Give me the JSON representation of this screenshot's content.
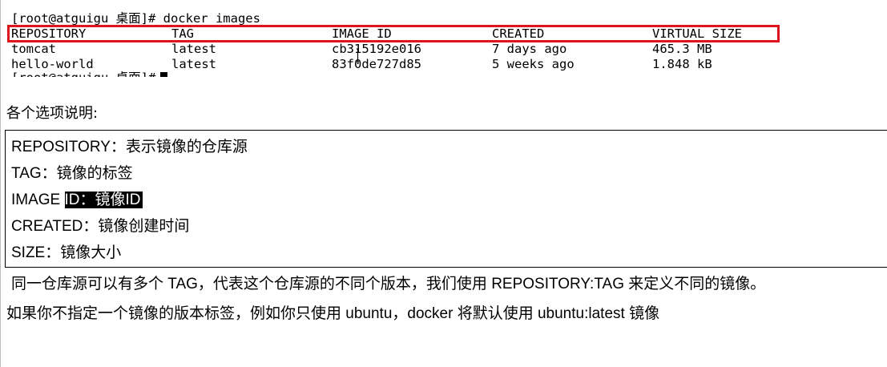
{
  "terminal": {
    "prompt_line": "[root@atguigu 桌面]# docker images",
    "headers": [
      "REPOSITORY",
      "TAG",
      "IMAGE ID",
      "CREATED",
      "VIRTUAL SIZE"
    ],
    "rows": [
      [
        "tomcat",
        "latest",
        "cb315192e016",
        "7 days ago",
        "465.3 MB"
      ],
      [
        "hello-world",
        "latest",
        "83f0de727d85",
        "5 weeks ago",
        "1.848 kB"
      ]
    ],
    "next_prompt": "[root@atguigu 桌面]#",
    "highlight_color": "#e0141b"
  },
  "doc": {
    "heading": "各个选项说明:",
    "options": [
      {
        "key": "REPOSITORY",
        "sep": "：",
        "desc": "表示镜像的仓库源"
      },
      {
        "key": "TAG",
        "sep": "：",
        "desc": "镜像的标签"
      },
      {
        "key": "IMAGE ",
        "sep": "",
        "desc": "ID：镜像ID"
      },
      {
        "key": "CREATED",
        "sep": "：",
        "desc": "镜像创建时间"
      },
      {
        "key": "SIZE",
        "sep": "：",
        "desc": "镜像大小"
      }
    ],
    "para1": "同一仓库源可以有多个 TAG，代表这个仓库源的不同个版本，我们使用 REPOSITORY:TAG 来定义不同的镜像。",
    "para2": "如果你不指定一个镜像的版本标签，例如你只使用 ubuntu，docker 将默认使用 ubuntu:latest 镜像"
  }
}
